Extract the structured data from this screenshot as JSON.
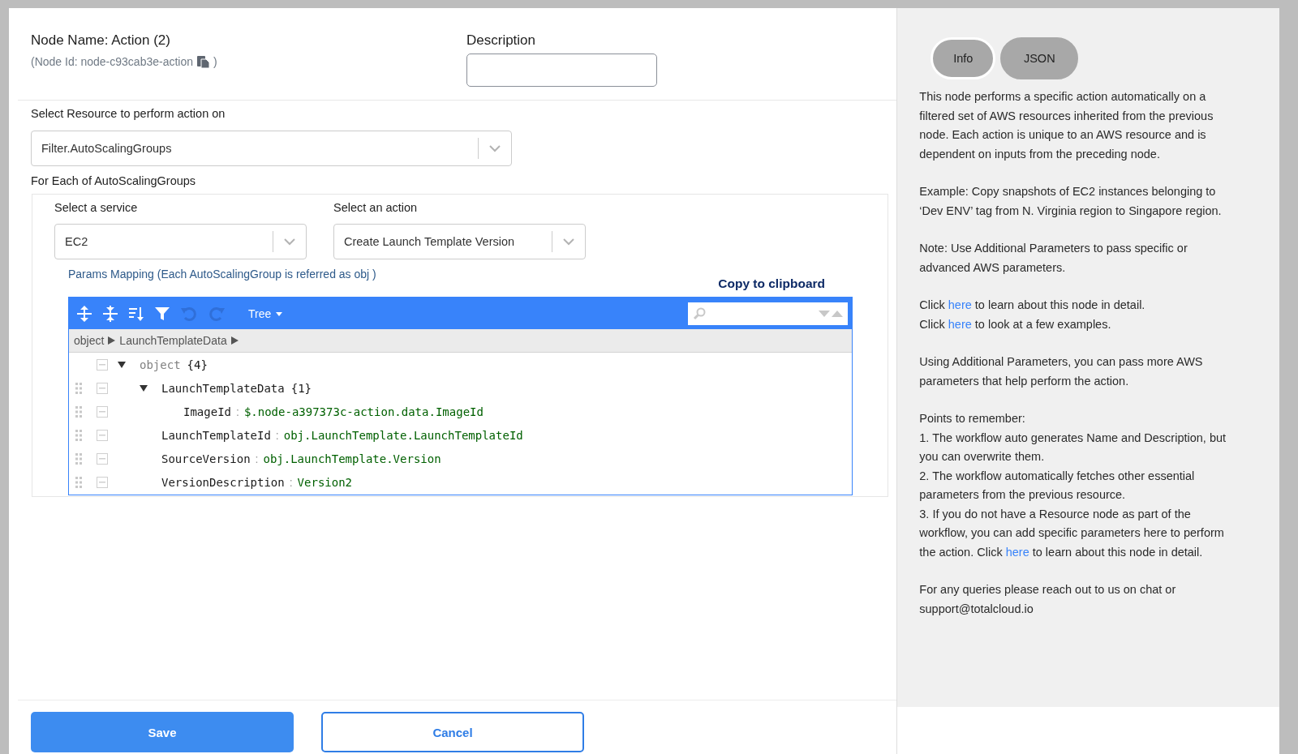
{
  "node": {
    "name": "Node Name: Action (2)",
    "id": "(Node Id: node-c93cab3e-action",
    "id_close": ")"
  },
  "description": {
    "label": "Description"
  },
  "resource": {
    "label": "Select Resource to perform action on",
    "value": "Filter.AutoScalingGroups"
  },
  "for_each": {
    "label": "For Each of AutoScalingGroups"
  },
  "service": {
    "label": "Select a service",
    "value": "EC2"
  },
  "action": {
    "label": "Select an action",
    "value": "Create Launch Template Version"
  },
  "params_mapping": {
    "label": "Params Mapping (Each AutoScalingGroup is referred as obj )",
    "copy_link": "Copy to clipboard"
  },
  "editor": {
    "mode": "Tree",
    "breadcrumb": [
      "object",
      "LaunchTemplateData"
    ],
    "tree": {
      "key": "object",
      "count": "{4}",
      "expanded": true,
      "children": [
        {
          "key": "LaunchTemplateData",
          "count": "{1}",
          "expanded": true,
          "children": [
            {
              "key": "ImageId",
              "separator": ":",
              "value": "$.node-a397373c-action.data.ImageId"
            }
          ]
        },
        {
          "key": "LaunchTemplateId",
          "separator": ":",
          "value": "obj.LaunchTemplate.LaunchTemplateId"
        },
        {
          "key": "SourceVersion",
          "separator": ":",
          "value": "obj.LaunchTemplate.Version"
        },
        {
          "key": "VersionDescription",
          "separator": ":",
          "value": "Version2"
        }
      ]
    }
  },
  "buttons": {
    "save": "Save",
    "cancel": "Cancel"
  },
  "side_tabs": [
    {
      "label": "Info",
      "selected": true
    },
    {
      "label": "JSON",
      "selected": false
    }
  ],
  "info_blocks": [
    {
      "lines": [
        [
          {
            "kind": "text",
            "text": "This node performs a specific action automatically on a filtered set of AWS resources inherited from the previous node. Each action is unique to an AWS resource and is dependent on inputs from the preceding node."
          }
        ]
      ]
    },
    {
      "lines": [
        [
          {
            "kind": "text",
            "text": "Example: Copy snapshots of EC2 instances belonging to ‘Dev ENV’ tag from N. Virginia region to Singapore region."
          }
        ]
      ]
    },
    {
      "lines": [
        [
          {
            "kind": "text",
            "text": "Note: Use Additional Parameters to pass specific or advanced AWS parameters."
          }
        ]
      ]
    },
    {
      "lines": [
        [
          {
            "kind": "text",
            "text": "Click "
          },
          {
            "kind": "link",
            "text": "here"
          },
          {
            "kind": "text",
            "text": " to learn about this node in detail."
          }
        ],
        [
          {
            "kind": "text",
            "text": "Click "
          },
          {
            "kind": "link",
            "text": "here"
          },
          {
            "kind": "text",
            "text": " to look at a few examples."
          }
        ]
      ]
    },
    {
      "lines": [
        [
          {
            "kind": "text",
            "text": "Using Additional Parameters, you can pass more AWS parameters that help perform the action."
          }
        ]
      ]
    },
    {
      "lines": [
        [
          {
            "kind": "text",
            "text": "Points to remember:"
          }
        ],
        [
          {
            "kind": "text",
            "text": "1. The workflow auto generates Name and Description, but you can overwrite them."
          }
        ],
        [
          {
            "kind": "text",
            "text": "2. The workflow automatically fetches other essential parameters from the previous resource."
          }
        ],
        [
          {
            "kind": "text",
            "text": "3. If you do not have a Resource node as part of the workflow, you can add specific parameters here to perform the action. Click "
          },
          {
            "kind": "link",
            "text": "here"
          },
          {
            "kind": "text",
            "text": " to learn about this node in detail."
          }
        ]
      ]
    },
    {
      "lines": [
        [
          {
            "kind": "text",
            "text": "For any queries please reach out to us on chat or support@totalcloud.io"
          }
        ]
      ]
    }
  ]
}
